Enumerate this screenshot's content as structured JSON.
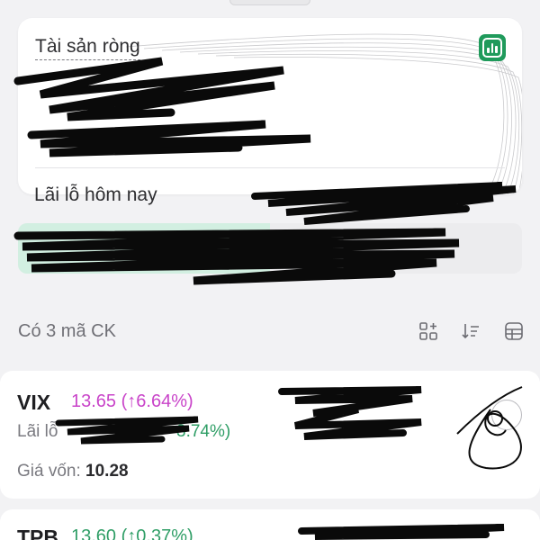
{
  "asset_card": {
    "title": "Tài sản ròng",
    "chart_button_icon": "bar-chart-icon",
    "accent": "#1f9a5b"
  },
  "pnl": {
    "label": "Lãi lỗ hôm nay",
    "positive_fill_color": "#d2efe1",
    "positive_fill_fraction": 0.5
  },
  "holdings_header": {
    "count_text": "Có 3 mã CK",
    "tools": [
      "add-stock-icon",
      "sort-icon",
      "grid-view-icon"
    ]
  },
  "stocks": [
    {
      "ticker": "VIX",
      "price_change": "13.65 (↑6.64%)",
      "price_color": "#c944c9",
      "pnl_label": "Lãi lỗ",
      "pnl_pct_partial": "3.74%)",
      "pnl_color": "#2f9e66",
      "cost_label": "Giá vốn: ",
      "cost_value": "10.28"
    },
    {
      "ticker": "TPB",
      "price_change": "13.60 (↑0.37%)",
      "price_color": "#2f9e66"
    }
  ],
  "colors": {
    "background": "#f2f2f4",
    "card": "#ffffff",
    "redaction": "#0a0a0a"
  }
}
